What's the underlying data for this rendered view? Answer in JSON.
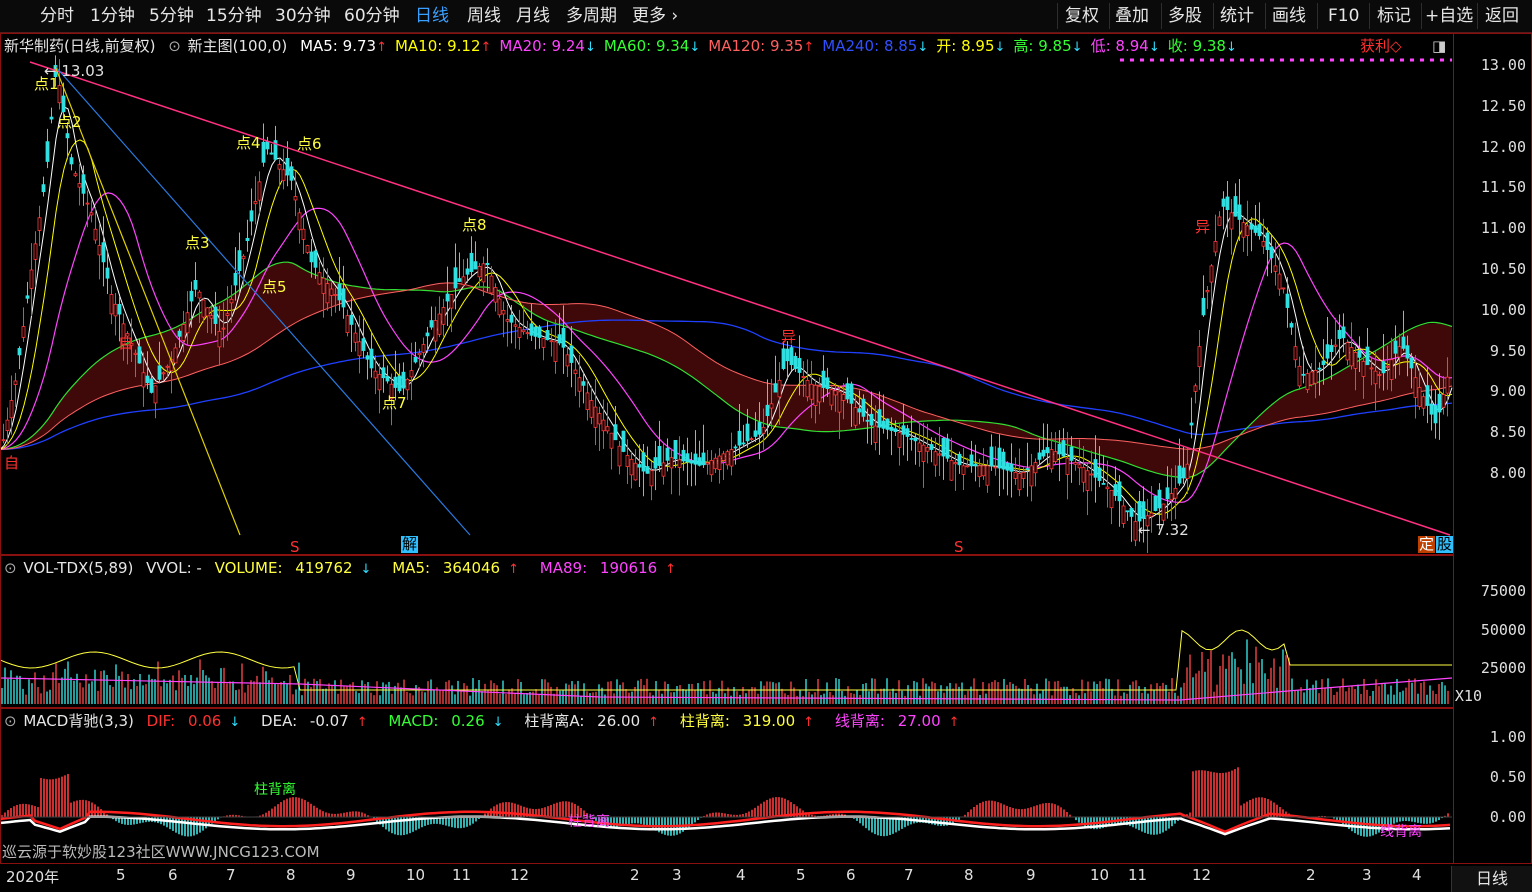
{
  "toolbar": {
    "left_items": [
      "分时",
      "1分钟",
      "5分钟",
      "15分钟",
      "30分钟",
      "60分钟",
      "日线",
      "周线",
      "月线",
      "多周期",
      "更多"
    ],
    "active": "日线",
    "more_icon": "chevron-right-icon",
    "right_items": [
      "复权",
      "叠加",
      "多股",
      "统计",
      "画线",
      "F10",
      "标记",
      "+自选",
      "返回"
    ]
  },
  "main": {
    "stock_name": "新华制药(日线,前复权)",
    "indicator": "新主图(100,0)",
    "ma": [
      {
        "label": "MA5:",
        "value": "9.73",
        "arrow": "↑",
        "color": "#ffffff"
      },
      {
        "label": "MA10:",
        "value": "9.12",
        "arrow": "↑",
        "color": "#ffff00"
      },
      {
        "label": "MA20:",
        "value": "9.24",
        "arrow": "↓",
        "color": "#ff44ff"
      },
      {
        "label": "MA60:",
        "value": "9.34",
        "arrow": "↓",
        "color": "#33ff33"
      },
      {
        "label": "MA120:",
        "value": "9.35",
        "arrow": "↑",
        "color": "#ff6060"
      },
      {
        "label": "MA240:",
        "value": "8.85",
        "arrow": "↓",
        "color": "#3050ff"
      },
      {
        "label": "开:",
        "value": "8.95",
        "arrow": "↓",
        "color": "#ffff00"
      },
      {
        "label": "高:",
        "value": "9.85",
        "arrow": "↓",
        "color": "#33ff33"
      },
      {
        "label": "低:",
        "value": "8.94",
        "arrow": "↓",
        "color": "#ff44ff"
      },
      {
        "label": "收:",
        "value": "9.38",
        "arrow": "↓",
        "color": "#33ff33"
      }
    ],
    "profit_label": "获利◇",
    "y_ticks": [
      "13.00",
      "12.50",
      "12.00",
      "11.50",
      "11.00",
      "10.50",
      "10.00",
      "9.50",
      "9.00",
      "8.50",
      "8.00"
    ],
    "high_marker": "13.03",
    "low_marker": "7.32",
    "points": [
      "点1",
      "点2",
      "点3",
      "点4",
      "点5",
      "点6",
      "点7",
      "点8"
    ],
    "signals": [
      "自",
      "自",
      "异",
      "异",
      "S",
      "解",
      "S",
      "定",
      "股"
    ]
  },
  "volume": {
    "title": "VOL-TDX(5,89)",
    "vvol": "VVOL: -",
    "volume_label": "VOLUME:",
    "volume_value": "419762",
    "ma5_label": "MA5:",
    "ma5_value": "364046",
    "ma89_label": "MA89:",
    "ma89_value": "190616",
    "y_ticks": [
      "75000",
      "50000",
      "25000"
    ],
    "unit": "X10"
  },
  "macd": {
    "title": "MACD背驰(3,3)",
    "dif_label": "DIF:",
    "dif_value": "0.06",
    "dea_label": "DEA:",
    "dea_value": "-0.07",
    "macd_label": "MACD:",
    "macd_value": "0.26",
    "zhu_a_label": "柱背离A:",
    "zhu_a_value": "26.00",
    "zhu_label": "柱背离:",
    "zhu_value": "319.00",
    "xian_label": "线背离:",
    "xian_value": "27.00",
    "y_ticks": [
      "1.00",
      "0.50",
      "0.00"
    ],
    "watermark": "巡云源于软妙股123社区WWW.JNCG123.COM",
    "annotations": [
      "柱背离",
      "柱背离",
      "线背离"
    ]
  },
  "x_axis": {
    "labels": [
      "2020年",
      "5",
      "6",
      "7",
      "8",
      "9",
      "10",
      "11",
      "12",
      "2",
      "3",
      "4",
      "5",
      "6",
      "7",
      "8",
      "9",
      "10",
      "11",
      "12",
      "2",
      "3",
      "4"
    ],
    "period_button": "日线"
  }
}
